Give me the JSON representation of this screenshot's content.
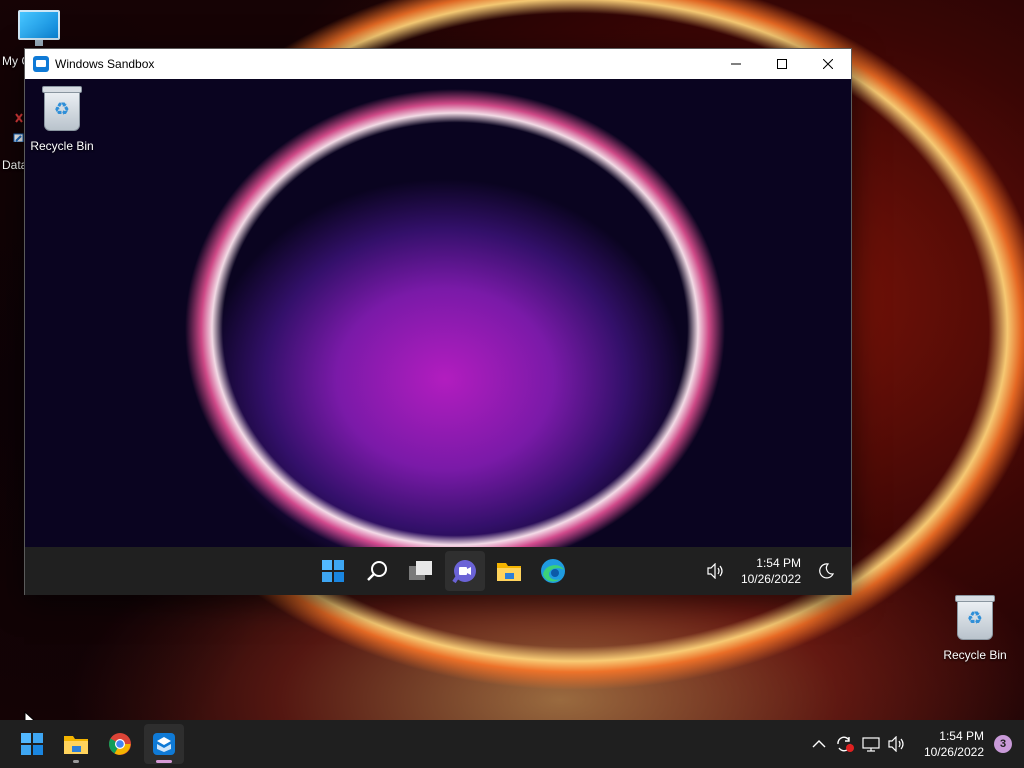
{
  "desktop": {
    "icons": [
      {
        "label": "My C"
      },
      {
        "label": "Data"
      },
      {
        "label": "Recycle Bin"
      }
    ]
  },
  "sandbox_window": {
    "title": "Windows Sandbox",
    "desktop_icon_label": "Recycle Bin",
    "taskbar": {
      "time": "1:54 PM",
      "date": "10/26/2022"
    }
  },
  "host_taskbar": {
    "time": "1:54 PM",
    "date": "10/26/2022",
    "notification_count": "3"
  },
  "icons": {
    "start": "windows-start-icon",
    "search": "search-icon",
    "task_view": "task-view-icon",
    "chat": "teams-chat-icon",
    "explorer": "file-explorer-icon",
    "edge": "edge-icon",
    "chrome": "chrome-icon",
    "sandbox": "windows-sandbox-icon"
  },
  "colors": {
    "accent": "#0078d4",
    "taskbar": "#202020",
    "badge": "#c99ad8"
  }
}
